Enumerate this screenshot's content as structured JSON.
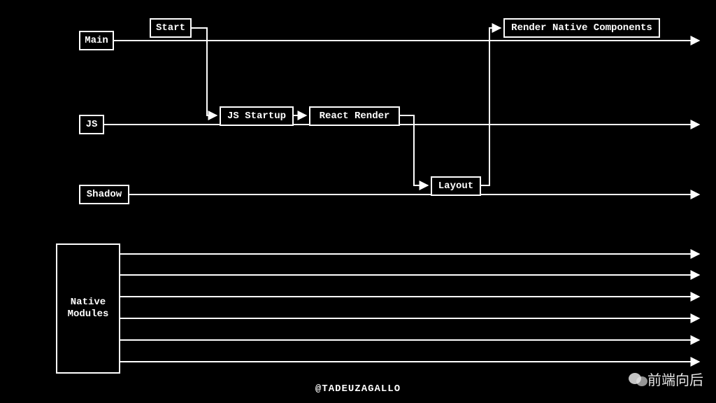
{
  "threads": {
    "main": {
      "label": "Main"
    },
    "js": {
      "label": "JS"
    },
    "shadow": {
      "label": "Shadow"
    },
    "native": {
      "label": "Native\nModules"
    }
  },
  "steps": {
    "start": {
      "label": "Start"
    },
    "js_startup": {
      "label": "JS Startup"
    },
    "react_render": {
      "label": "React Render"
    },
    "layout": {
      "label": "Layout"
    },
    "render_native_components": {
      "label": "Render Native Components"
    }
  },
  "credit": "@TADEUZAGALLO",
  "watermark_text": "前端向后"
}
